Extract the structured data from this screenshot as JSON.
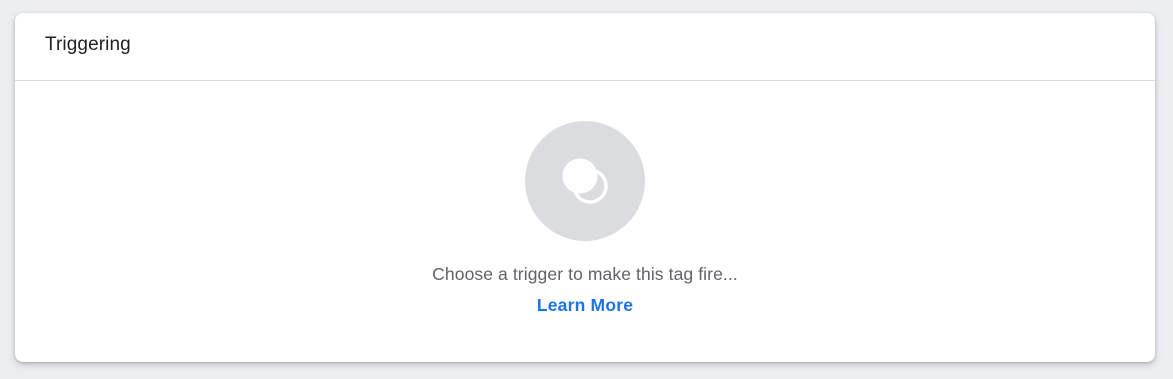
{
  "card": {
    "title": "Triggering"
  },
  "empty_state": {
    "icon": "trigger-icon",
    "message": "Choose a trigger to make this tag fire...",
    "link_label": "Learn More"
  },
  "colors": {
    "accent": "#1a73e8",
    "icon_circle": "#dadce0",
    "text_secondary": "#5f6368",
    "text_primary": "#202124"
  }
}
